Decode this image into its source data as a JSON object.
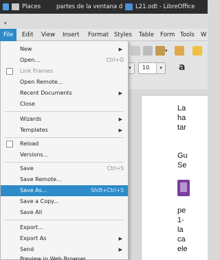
{
  "panel": {
    "places": "Places",
    "browser_tab": "partes de la ventana de Writ...",
    "app_title": "L21.odt - LibreOffice"
  },
  "menubar": [
    "File",
    "Edit",
    "View",
    "Insert",
    "Format",
    "Styles",
    "Table",
    "Form",
    "Tools",
    "W"
  ],
  "toolbar": {
    "font_size": "10",
    "partial_char": "a"
  },
  "file_menu": {
    "new": "New",
    "open": "Open...",
    "open_shortcut": "Ctrl+O",
    "link_frames": "Link Frames",
    "open_remote": "Open Remote...",
    "recent": "Recent Documents",
    "close": "Close",
    "wizards": "Wizards",
    "templates": "Templates",
    "reload": "Reload",
    "versions": "Versions...",
    "save": "Save",
    "save_shortcut": "Ctrl+S",
    "save_remote": "Save Remote...",
    "save_as": "Save As...",
    "save_as_shortcut": "Shift+Ctrl+S",
    "save_copy": "Save a Copy...",
    "save_all": "Save All",
    "export": "Export...",
    "export_as": "Export As",
    "send": "Send",
    "preview": "Preview in Web Browser"
  },
  "document": {
    "lines": [
      "La",
      "ha",
      "tar",
      "Gu",
      "Se",
      "pe",
      "1-",
      "la",
      "ca",
      "ele"
    ]
  },
  "colors": {
    "highlight": "#2d8bc9",
    "panel": "#2c2c2c"
  }
}
